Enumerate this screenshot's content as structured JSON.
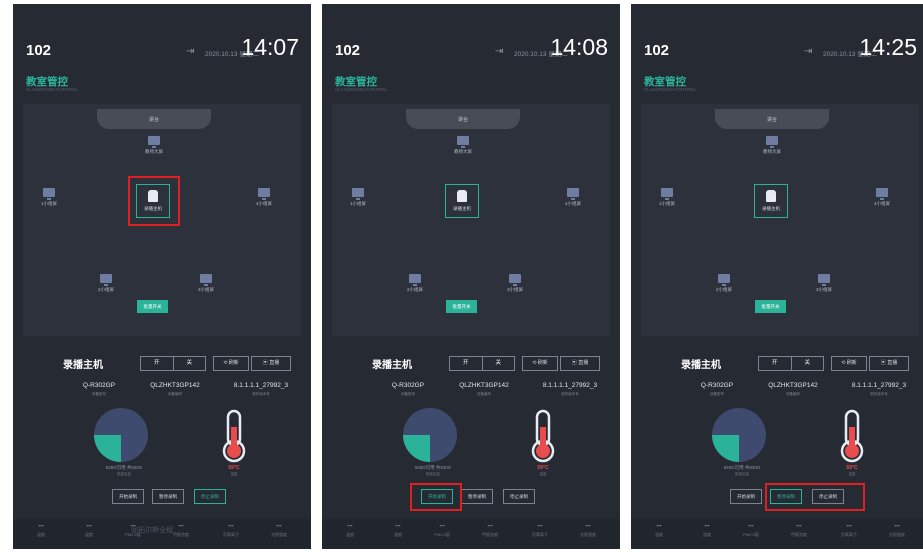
{
  "panels": [
    {
      "room": "102",
      "date": "2020.10.13 星期二",
      "time": "14:07",
      "title": "教室管控",
      "subtitle": "CLASSROOM CONTROL",
      "podium": "讲台",
      "devices": {
        "teacher": "教师大屏",
        "left": "1小组屏",
        "right": "4小组屏",
        "bottom_left": "2小组屏",
        "bottom_right": "3小组屏",
        "host": "录播主机"
      },
      "group_open": "批量开关",
      "host_title": "录播主机",
      "toggle": {
        "on": "开",
        "off": "关"
      },
      "refresh": "刷新",
      "live": "直播",
      "info": [
        {
          "value": "Q-R302GP",
          "label": "设备型号"
        },
        {
          "value": "QLZHKT3GP142",
          "label": "设备编号"
        },
        {
          "value": "8.1.1.1.1_27992_3",
          "label": "软件版本号"
        }
      ],
      "disk": {
        "text": "928G可用 共930G",
        "sub": "磁盘容量",
        "used_fraction": 0.25
      },
      "temperature": {
        "value": "59°C",
        "label": "温度"
      },
      "actions": {
        "start": "开始录制",
        "pause": "暂停录制",
        "stop": "停止录制"
      },
      "active_action": "stop",
      "footer": [
        {
          "value": "--",
          "label": "温度"
        },
        {
          "value": "--",
          "label": "湿度"
        },
        {
          "value": "--",
          "label": "PM2.5值"
        },
        {
          "value": "--",
          "label": "甲醛浓度"
        },
        {
          "value": "--",
          "label": "负氧离子"
        },
        {
          "value": "--",
          "label": "光照强度"
        }
      ],
      "watermark": "@拓尔斯全程",
      "highlight": "host"
    },
    {
      "room": "102",
      "date": "2020.10.13 星期二",
      "time": "14:08",
      "title": "教室管控",
      "subtitle": "CLASSROOM CONTROL",
      "podium": "讲台",
      "devices": {
        "teacher": "教师大屏",
        "left": "1小组屏",
        "right": "4小组屏",
        "bottom_left": "2小组屏",
        "bottom_right": "3小组屏",
        "host": "录播主机"
      },
      "group_open": "批量开关",
      "host_title": "录播主机",
      "toggle": {
        "on": "开",
        "off": "关"
      },
      "refresh": "刷新",
      "live": "直播",
      "info": [
        {
          "value": "Q-R302GP",
          "label": "设备型号"
        },
        {
          "value": "QLZHKT3GP142",
          "label": "设备编号"
        },
        {
          "value": "8.1.1.1.1_27992_3",
          "label": "软件版本号"
        }
      ],
      "disk": {
        "text": "928G可用 共930G",
        "sub": "磁盘容量",
        "used_fraction": 0.25
      },
      "temperature": {
        "value": "59°C",
        "label": "温度"
      },
      "actions": {
        "start": "开始录制",
        "pause": "暂停录制",
        "stop": "停止录制"
      },
      "active_action": "start",
      "footer": [
        {
          "value": "--",
          "label": "温度"
        },
        {
          "value": "--",
          "label": "湿度"
        },
        {
          "value": "--",
          "label": "PM2.5值"
        },
        {
          "value": "--",
          "label": "甲醛浓度"
        },
        {
          "value": "--",
          "label": "负氧离子"
        },
        {
          "value": "--",
          "label": "光照强度"
        }
      ],
      "watermark": "",
      "highlight": "start"
    },
    {
      "room": "102",
      "date": "2020.10.13 星期二",
      "time": "14:25",
      "title": "教室管控",
      "subtitle": "CLASSROOM CONTROL",
      "podium": "讲台",
      "devices": {
        "teacher": "教师大屏",
        "left": "1小组屏",
        "right": "4小组屏",
        "bottom_left": "2小组屏",
        "bottom_right": "3小组屏",
        "host": "录播主机"
      },
      "group_open": "批量开关",
      "host_title": "录播主机",
      "toggle": {
        "on": "开",
        "off": "关"
      },
      "refresh": "刷新",
      "live": "直播",
      "info": [
        {
          "value": "Q-R302GP",
          "label": "设备型号"
        },
        {
          "value": "QLZHKT3GP142",
          "label": "设备编号"
        },
        {
          "value": "8.1.1.1.1_27992_3",
          "label": "软件版本号"
        }
      ],
      "disk": {
        "text": "928G可用 共930G",
        "sub": "磁盘容量",
        "used_fraction": 0.25
      },
      "temperature": {
        "value": "59°C",
        "label": "温度"
      },
      "actions": {
        "start": "开始录制",
        "pause": "暂停录制",
        "stop": "停止录制"
      },
      "active_action": "pause",
      "footer": [
        {
          "value": "--",
          "label": "温度"
        },
        {
          "value": "--",
          "label": "湿度"
        },
        {
          "value": "--",
          "label": "PM2.5值"
        },
        {
          "value": "--",
          "label": "甲醛浓度"
        },
        {
          "value": "--",
          "label": "负氧离子"
        },
        {
          "value": "--",
          "label": "光照强度"
        }
      ],
      "watermark": "",
      "highlight": "pause-stop"
    }
  ],
  "colors": {
    "accent": "#2bb39a",
    "highlight": "#e02020",
    "background": "#262a33",
    "pie_remaining": "#3e4a6e",
    "temp_red": "#e84d4d"
  }
}
